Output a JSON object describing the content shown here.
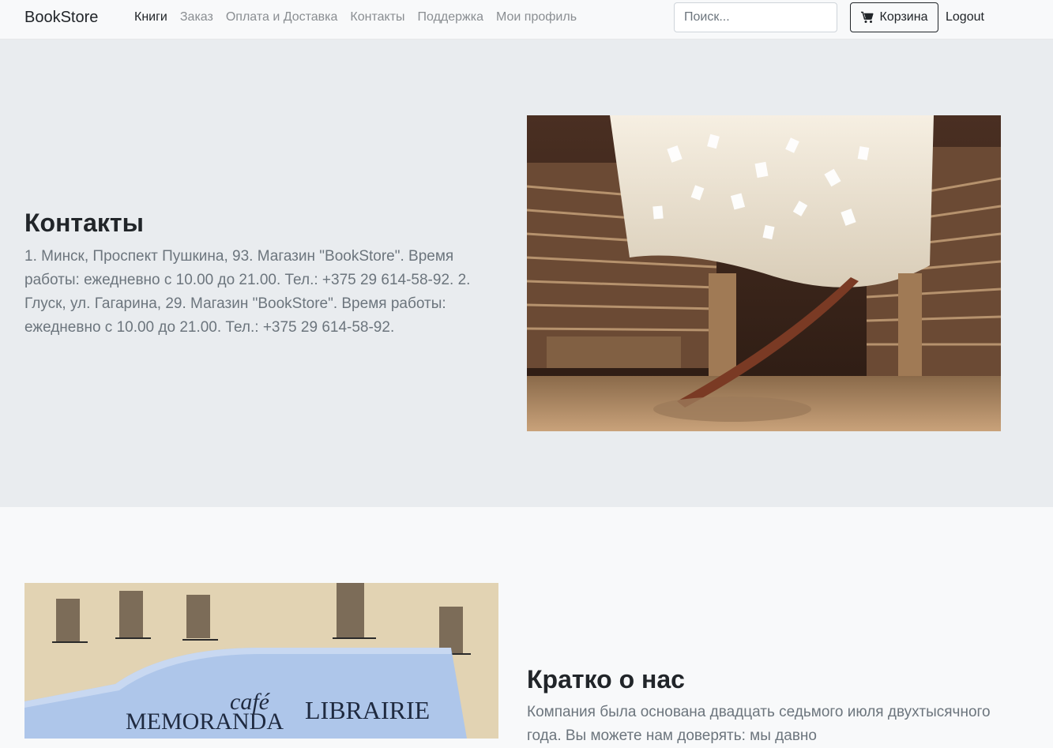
{
  "navbar": {
    "brand": "BookStore",
    "links": [
      "Книги",
      "Заказ",
      "Оплата и Доставка",
      "Контакты",
      "Поддержка",
      "Мои профиль"
    ],
    "search_placeholder": "Поиск...",
    "cart_label": "Корзина",
    "cart_icon": "cart-icon",
    "logout_label": "Logout"
  },
  "contacts": {
    "title": "Контакты",
    "text": "1. Минск, Проспект Пушкина, 93. Магазин \"BookStore\". Время работы: ежедневно с 10.00 до 21.00. Тел.: +375 29 614-58-92. 2. Глуск, ул. Гагарина, 29. Магазин \"BookStore\". Время работы: ежедневно с 10.00 до 21.00. Тел.: +375 29 614-58-92."
  },
  "about": {
    "title": "Кратко о нас",
    "text": "Компания была основана двадцать седьмого июля двухтысячного года. Вы можете нам доверять: мы давно"
  },
  "images": {
    "storefront_signs": [
      "MEMORANDA",
      "café",
      "LIBRAIRIE"
    ]
  },
  "colors": {
    "navbar_bg": "#f8f9fa",
    "section_bg": "#e9ecef",
    "muted_text": "#6c757d"
  }
}
